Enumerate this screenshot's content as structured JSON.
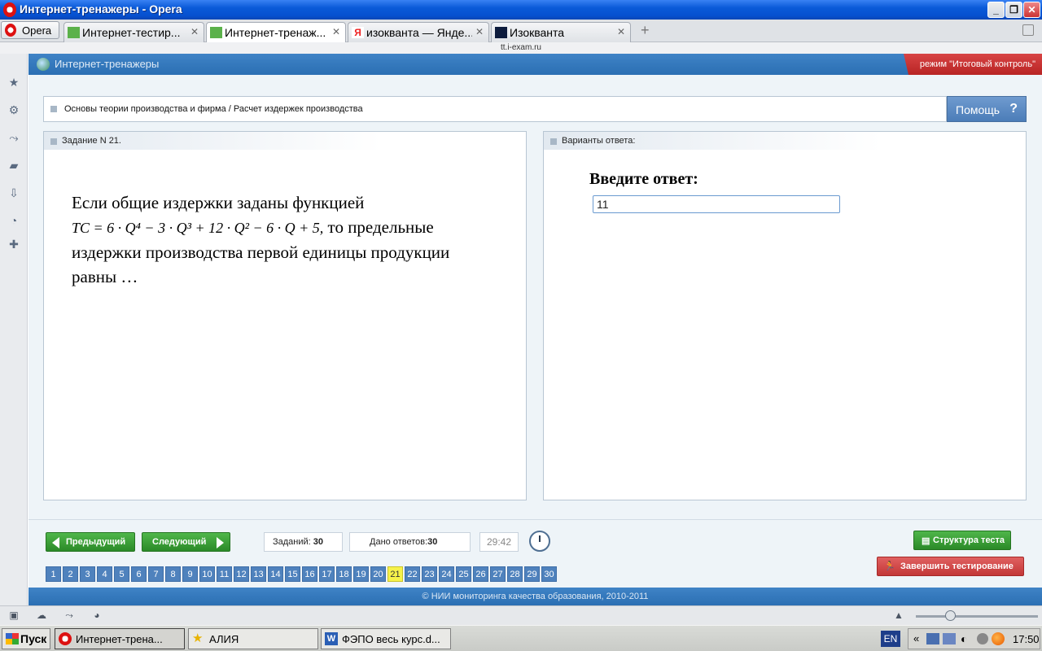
{
  "window": {
    "title": "Интернет-тренажеры - Opera"
  },
  "browser": {
    "menu_label": "Opera",
    "tabs": [
      {
        "label": "Интернет-тестир..."
      },
      {
        "label": "Интернет-тренаж..."
      },
      {
        "label": "изокванта — Яндe..."
      },
      {
        "label": "Изокванта"
      }
    ],
    "url": "tt.i-exam.ru"
  },
  "app": {
    "title": "Интернет-тренажеры",
    "mode": "режим \"Итоговый контроль\"",
    "breadcrumb": "Основы теории производства и фирма / Расчет издержек производства",
    "help_label": "Помощь",
    "task_header": "Задание N 21.",
    "question_line1": "Если общие издержки заданы функцией",
    "question_formula": "TC = 6 · Q⁴ − 3 · Q³ + 12 · Q² − 6 · Q + 5,",
    "question_line2": " то предельные",
    "question_line3": "издержки производства первой единицы продукции",
    "question_line4": "равны …",
    "answers_header": "Варианты ответа:",
    "answer_prompt": "Введите ответ:",
    "answer_value": "11"
  },
  "controls": {
    "prev_label": "Предыдущий",
    "next_label": "Следующий",
    "tasks_label": "Заданий: ",
    "tasks_count": "30",
    "answers_label": "Дано ответов:",
    "answers_count": "30",
    "timer": "29:42",
    "structure_label": "Структура теста",
    "finish_label": "Завершить тестирование",
    "question_numbers": [
      "1",
      "2",
      "3",
      "4",
      "5",
      "6",
      "7",
      "8",
      "9",
      "10",
      "11",
      "12",
      "13",
      "14",
      "15",
      "16",
      "17",
      "18",
      "19",
      "20",
      "21",
      "22",
      "23",
      "24",
      "25",
      "26",
      "27",
      "28",
      "29",
      "30"
    ],
    "current_question": "21"
  },
  "footer": {
    "text": "© НИИ мониторинга качества образования, 2010-2011"
  },
  "taskbar": {
    "start_label": "Пуск",
    "items": [
      {
        "label": "Интернет-трена..."
      },
      {
        "label": "АЛИЯ"
      },
      {
        "label": "ФЭПО весь курс.d..."
      }
    ],
    "lang": "EN",
    "clock": "17:50"
  },
  "colors": {
    "app_blue": "#2b6fb3",
    "green_button": "#2b8a28",
    "red_button": "#c23737",
    "current_qnum": "#f6f24a"
  }
}
